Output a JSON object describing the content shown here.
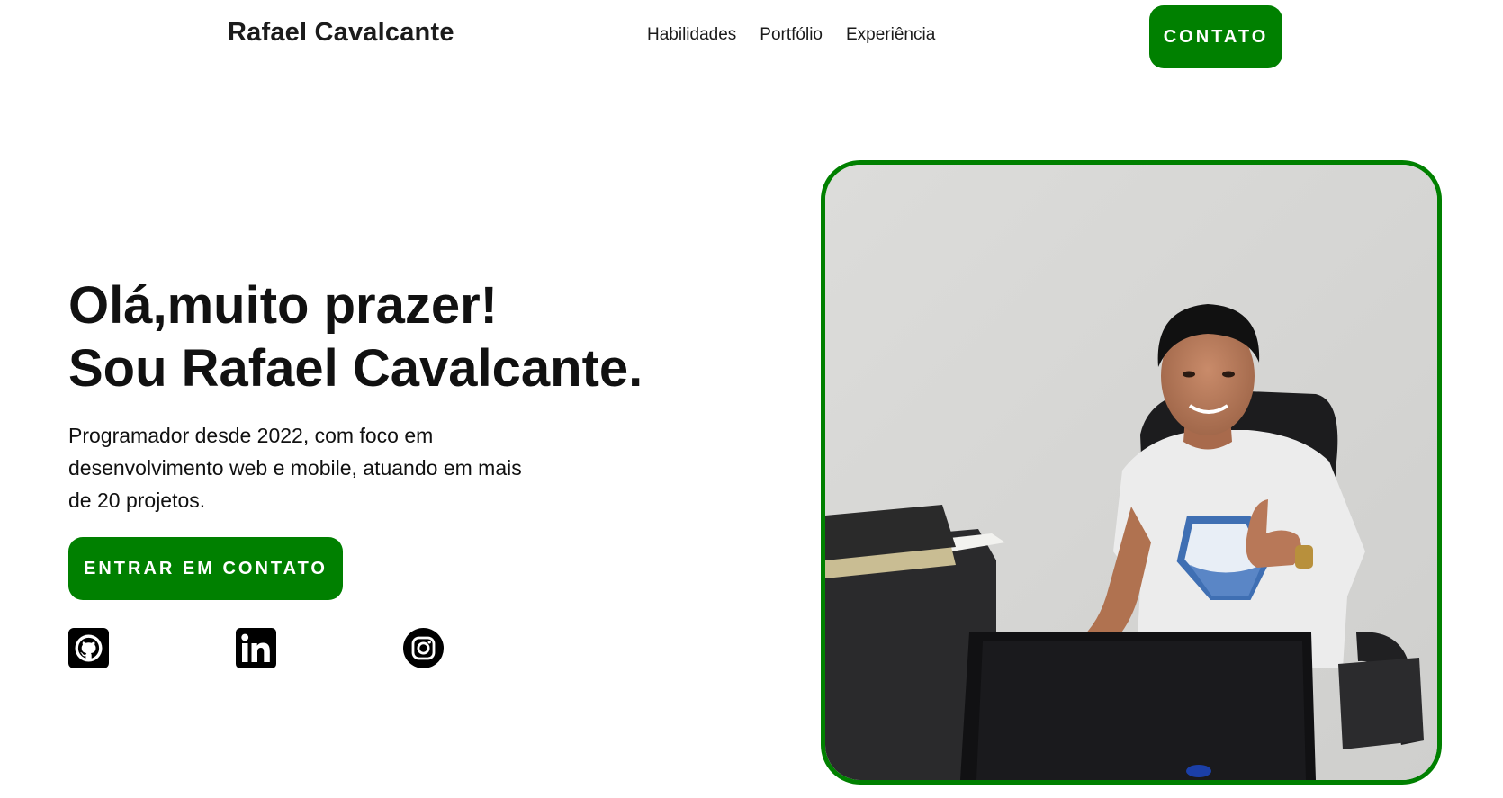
{
  "header": {
    "logo": "Rafael Cavalcante",
    "nav": [
      "Habilidades",
      "Portfólio",
      "Experiência"
    ],
    "contact_button": "CONTATO"
  },
  "hero": {
    "title_line1": "Olá,muito prazer!",
    "title_line2": "Sou Rafael Cavalcante.",
    "description": "Programador desde 2022, com foco em desenvolvimento web e mobile, atuando em mais de 20 projetos.",
    "cta_button": "ENTRAR EM CONTATO"
  },
  "social": [
    {
      "icon": "github-icon"
    },
    {
      "icon": "linkedin-icon"
    },
    {
      "icon": "instagram-icon"
    }
  ],
  "photo": {
    "subject": "man at desk giving thumbs up"
  },
  "colors": {
    "accent": "#008000",
    "text": "#111111",
    "background": "#ffffff"
  }
}
